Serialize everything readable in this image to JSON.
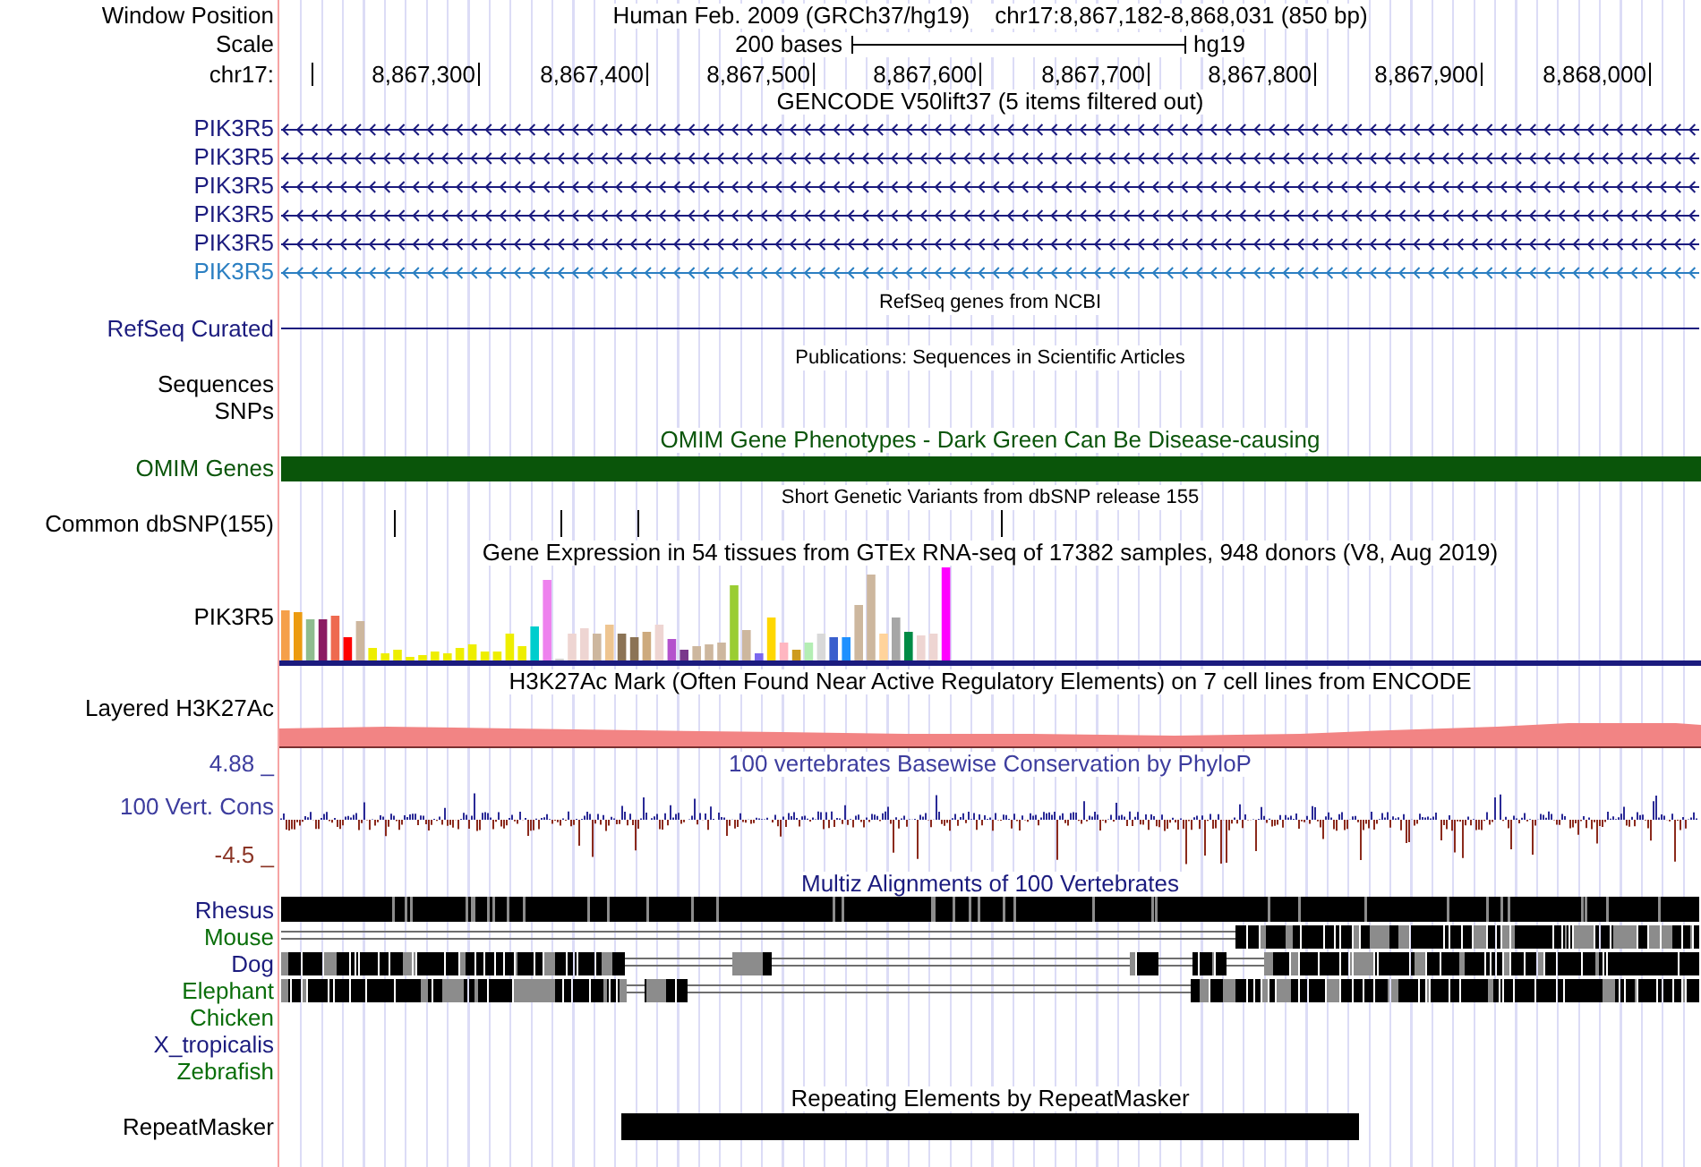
{
  "header": {
    "position": {
      "label": "Window Position",
      "assembly": "Human Feb. 2009 (GRCh37/hg19)",
      "range": "chr17:8,867,182-8,868,031 (850 bp)"
    },
    "scale": {
      "label": "Scale",
      "length": "200 bases",
      "assembly": "hg19"
    },
    "ruler": {
      "label": "chr17:",
      "ticks": [
        "8,867,300",
        "8,867,400",
        "8,867,500",
        "8,867,600",
        "8,867,700",
        "8,867,800",
        "8,867,900",
        "8,868,000"
      ]
    }
  },
  "tracks": [
    {
      "kind": "genes",
      "title": "GENCODE V50lift37 (5 items filtered out)",
      "items": [
        {
          "label": "PIK3R5",
          "color": "#1b1b7e"
        },
        {
          "label": "PIK3R5",
          "color": "#1b1b7e"
        },
        {
          "label": "PIK3R5",
          "color": "#1b1b7e"
        },
        {
          "label": "PIK3R5",
          "color": "#1b1b7e"
        },
        {
          "label": "PIK3R5",
          "color": "#1b1b7e"
        },
        {
          "label": "PIK3R5",
          "color": "#2b7fc2"
        }
      ]
    },
    {
      "kind": "line",
      "title": "RefSeq genes from NCBI",
      "label": "RefSeq Curated",
      "color": "#1b1b7e"
    },
    {
      "kind": "labels",
      "title": "Publications: Sequences in Scientific Articles",
      "labels": [
        "Sequences",
        "SNPs"
      ]
    },
    {
      "kind": "bar",
      "title": "OMIM Gene Phenotypes - Dark Green Can Be Disease-causing",
      "label": "OMIM Genes",
      "color": "#0a550a"
    },
    {
      "kind": "ticks",
      "title": "Short Genetic Variants from dbSNP release 155",
      "label": "Common dbSNP(155)"
    },
    {
      "kind": "expression",
      "title": "Gene Expression in 54 tissues from GTEx RNA-seq of 17382 samples, 948 donors (V8, Aug 2019)",
      "label": "PIK3R5"
    },
    {
      "kind": "layered",
      "title": "H3K27Ac Mark (Often Found Near Active Regulatory Elements) on 7 cell lines from ENCODE",
      "label": "Layered H3K27Ac"
    },
    {
      "kind": "wiggle",
      "title": "100 vertebrates Basewise Conservation by PhyloP",
      "label": "100 Vert. Cons",
      "max": "4.88 _",
      "min": "-4.5 _",
      "color": "#3d3d9e"
    },
    {
      "kind": "alignment",
      "title": "Multiz Alignments of 100 Vertebrates",
      "species": [
        {
          "label": "Rhesus",
          "color": "#1b1b7e"
        },
        {
          "label": "Mouse",
          "color": "#0a6e0a"
        },
        {
          "label": "Dog",
          "color": "#1b1b7e"
        },
        {
          "label": "Elephant",
          "color": "#0a6e0a"
        },
        {
          "label": "Chicken",
          "color": "#0a6e0a"
        },
        {
          "label": "X_tropicalis",
          "color": "#1b1b7e"
        },
        {
          "label": "Zebrafish",
          "color": "#0a6e0a"
        }
      ]
    },
    {
      "kind": "repeats",
      "title": "Repeating Elements by RepeatMasker",
      "label": "RepeatMasker"
    }
  ]
}
